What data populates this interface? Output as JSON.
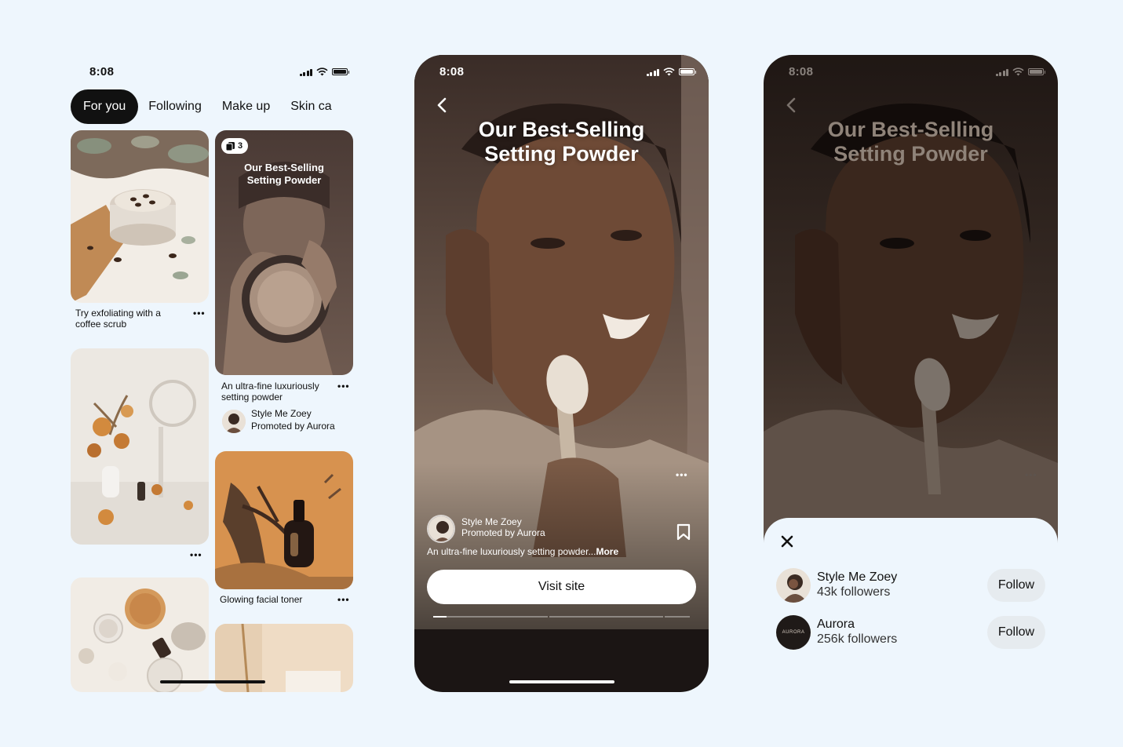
{
  "status_time": "8:08",
  "feed": {
    "tabs": [
      "For you",
      "Following",
      "Make up",
      "Skin ca"
    ],
    "pins": {
      "coffee_scrub_caption": "Try exfoliating with a coffee scrub",
      "promo_title": "Our Best-Selling Setting Powder",
      "promo_count": "3",
      "promo_caption": "An ultra-fine luxuriously setting powder",
      "promo_creator": "Style Me Zoey",
      "promo_sponsor": "Promoted by Aurora",
      "toner_caption": "Glowing facial toner"
    },
    "more_glyph": "•••"
  },
  "closeup": {
    "title_line1": "Our Best-Selling",
    "title_line2": "Setting Powder",
    "creator": "Style Me Zoey",
    "sponsor": "Promoted by Aurora",
    "description": "An ultra-fine luxuriously setting powder...",
    "more_link": "More",
    "visit_label": "Visit site",
    "progress_segments": 3,
    "progress_active": 0.04
  },
  "sheet": {
    "users": [
      {
        "name": "Style Me Zoey",
        "followers": "43k followers",
        "button": "Follow"
      },
      {
        "name": "Aurora",
        "followers": "256k followers",
        "button": "Follow",
        "logo": "AURORA"
      }
    ]
  },
  "colors": {
    "background": "#eef6fd",
    "dark": "#1b1514",
    "accent_orange": "#d7924f"
  },
  "icons": [
    "signal-icon",
    "wifi-icon",
    "battery-icon",
    "back-chevron-icon",
    "save-icon",
    "close-icon",
    "more-icon",
    "carousel-icon"
  ]
}
